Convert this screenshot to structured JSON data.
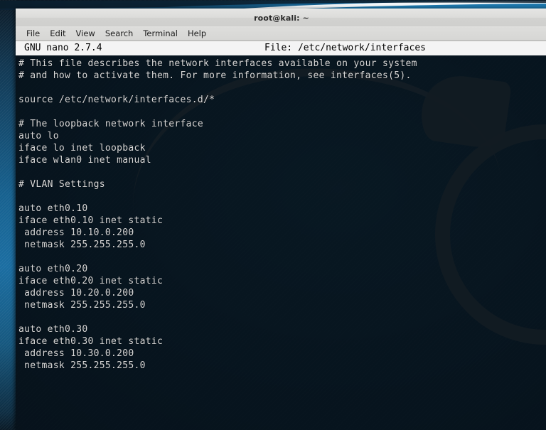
{
  "desktop": {
    "wallpaper_name": "kali-dragon-wallpaper",
    "colors": {
      "band_blue": "#1b6ea2",
      "body_dark": "#0d2230",
      "dragon_gray": "#3e3e3e"
    }
  },
  "window": {
    "title": "root@kali: ~",
    "menubar": [
      {
        "label": "File"
      },
      {
        "label": "Edit"
      },
      {
        "label": "View"
      },
      {
        "label": "Search"
      },
      {
        "label": "Terminal"
      },
      {
        "label": "Help"
      }
    ]
  },
  "nano": {
    "version_label": "GNU nano 2.7.4",
    "file_label": "File: /etc/network/interfaces",
    "colors": {
      "header_bg": "#f4f4f4",
      "header_fg": "#000000",
      "terminal_fg": "#d8d8d8"
    },
    "lines": [
      "# This file describes the network interfaces available on your system",
      "# and how to activate them. For more information, see interfaces(5).",
      "",
      "source /etc/network/interfaces.d/*",
      "",
      "# The loopback network interface",
      "auto lo",
      "iface lo inet loopback",
      "iface wlan0 inet manual",
      "",
      "# VLAN Settings",
      "",
      "auto eth0.10",
      "iface eth0.10 inet static",
      " address 10.10.0.200",
      " netmask 255.255.255.0",
      "",
      "auto eth0.20",
      "iface eth0.20 inet static",
      " address 10.20.0.200",
      " netmask 255.255.255.0",
      "",
      "auto eth0.30",
      "iface eth0.30 inet static",
      " address 10.30.0.200",
      " netmask 255.255.255.0",
      "",
      "",
      "",
      ""
    ]
  }
}
